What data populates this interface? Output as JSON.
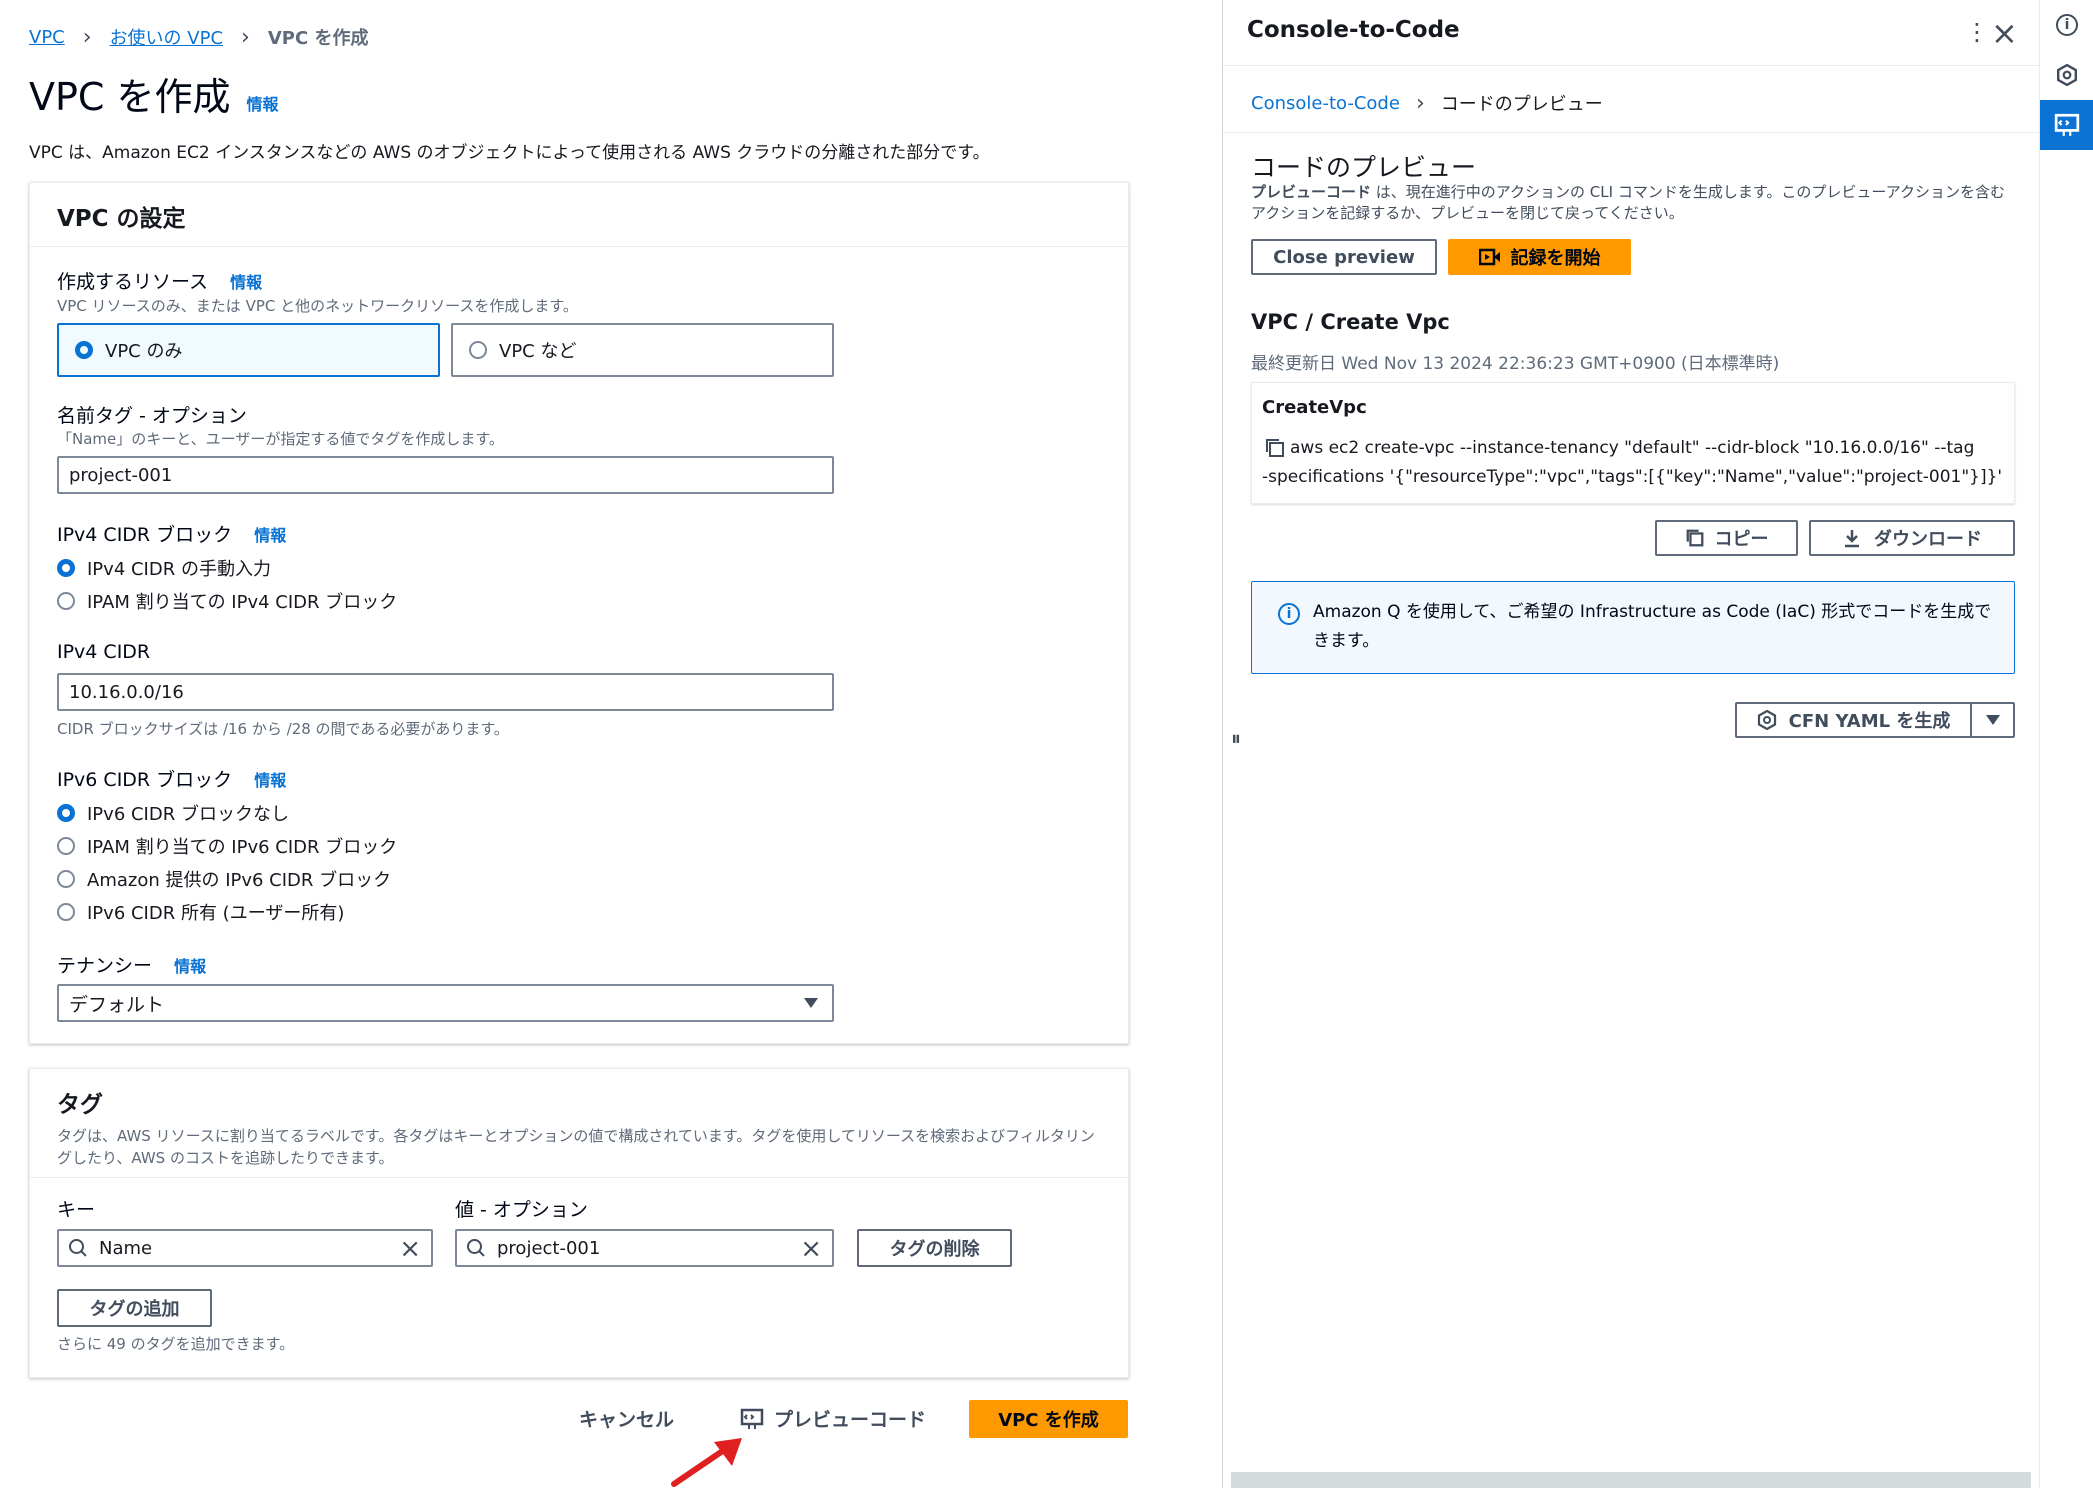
{
  "breadcrumb": {
    "item1": "VPC",
    "item2": "お使いの VPC",
    "current": "VPC を作成"
  },
  "page": {
    "title": "VPC を作成",
    "info": "情報",
    "description": "VPC は、Amazon EC2 インスタンスなどの AWS のオブジェクトによって使用される AWS クラウドの分離された部分です。"
  },
  "settings": {
    "header": "VPC の設定",
    "resources": {
      "label": "作成するリソース",
      "info": "情報",
      "desc": "VPC リソースのみ、または VPC と他のネットワークリソースを作成します。",
      "options": [
        "VPC のみ",
        "VPC など"
      ],
      "selected": 0
    },
    "name_tag": {
      "label": "名前タグ - オプション",
      "desc": "「Name」のキーと、ユーザーが指定する値でタグを作成します。",
      "value": "project-001"
    },
    "ipv4_block": {
      "label": "IPv4 CIDR ブロック",
      "info": "情報",
      "options": [
        "IPv4 CIDR の手動入力",
        "IPAM 割り当ての IPv4 CIDR ブロック"
      ],
      "selected": 0
    },
    "ipv4_cidr": {
      "label": "IPv4 CIDR",
      "value": "10.16.0.0/16",
      "hint": "CIDR ブロックサイズは /16 から /28 の間である必要があります。"
    },
    "ipv6_block": {
      "label": "IPv6 CIDR ブロック",
      "info": "情報",
      "options": [
        "IPv6 CIDR ブロックなし",
        "IPAM 割り当ての IPv6 CIDR ブロック",
        "Amazon 提供の IPv6 CIDR ブロック",
        "IPv6 CIDR 所有 (ユーザー所有)"
      ],
      "selected": 0
    },
    "tenancy": {
      "label": "テナンシー",
      "info": "情報",
      "value": "デフォルト"
    }
  },
  "tags": {
    "header": "タグ",
    "desc": "タグは、AWS リソースに割り当てるラベルです。各タグはキーとオプションの値で構成されています。タグを使用してリソースを検索およびフィルタリングしたり、AWS のコストを追跡したりできます。",
    "key_label": "キー",
    "value_label": "値 - オプション",
    "key_value": "Name",
    "value_value": "project-001",
    "remove_label": "タグの削除",
    "add_label": "タグの追加",
    "remaining": "さらに 49 のタグを追加できます。"
  },
  "footer": {
    "cancel": "キャンセル",
    "preview": "プレビューコード",
    "create": "VPC を作成"
  },
  "drawer": {
    "title": "Console-to-Code",
    "crumb_link": "Console-to-Code",
    "crumb_current": "コードのプレビュー",
    "section_title": "コードのプレビュー",
    "desc_bold": "プレビューコード",
    "desc_rest": " は、現在進行中のアクションの CLI コマンドを生成します。このプレビューアクションを含むアクションを記録するか、プレビューを閉じて戻ってください。",
    "close_preview": "Close preview",
    "start_record": "記録を開始",
    "op_title": "VPC / Create Vpc",
    "updated": "最終更新日 Wed Nov 13 2024 22:36:23 GMT+0900 (日本標準時)",
    "code_title": "CreateVpc",
    "code_line1": "aws ec2 create-vpc --instance-tenancy \"default\" --cidr-block \"10.16.0.0/16\" --tag",
    "code_line2": "-specifications '{\"resourceType\":\"vpc\",\"tags\":[{\"key\":\"Name\",\"value\":\"project-001\"}]}'",
    "copy": "コピー",
    "download": "ダウンロード",
    "alert": "Amazon Q を使用して、ご希望の Infrastructure as Code (IaC) 形式でコードを生成できます。",
    "generate": "CFN YAML を生成"
  },
  "colors": {
    "accent": "#0972d3",
    "primary": "#ff9900",
    "arrow": "#e02020"
  }
}
